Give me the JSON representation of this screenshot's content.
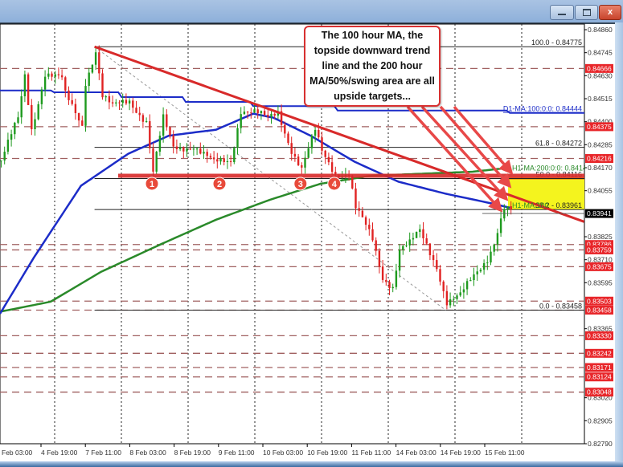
{
  "window": {
    "close_label": "x"
  },
  "annotation": "The 100 hour MA, the topside downward trend line and the 200 hour MA/50%/swing area are all upside targets...",
  "colors": {
    "bull": "#1e9a1e",
    "bear": "#e02222",
    "ma100": "#1c2cc8",
    "ma200": "#2a8a2a",
    "trend": "#d82a2a",
    "level_label": "#e8262a",
    "zone": "#f4f41e"
  },
  "chart_data": {
    "type": "candlestick",
    "title": "",
    "ylim": [
      0.8279,
      0.8486
    ],
    "y_ticks": [
      "0.84860",
      "0.84745",
      "0.84630",
      "0.84515",
      "0.84400",
      "0.84285",
      "0.84170",
      "0.84055",
      "0.83825",
      "0.83710",
      "0.83595",
      "0.83365",
      "0.83020",
      "0.82905",
      "0.82790"
    ],
    "x_ticks": [
      {
        "index": 12,
        "label": "4 Feb 19:00"
      },
      {
        "index": 25,
        "label": "7 Feb 11:00"
      },
      {
        "index": 38,
        "label": "8 Feb 03:00"
      },
      {
        "index": 51,
        "label": "8 Feb 19:00"
      },
      {
        "index": 64,
        "label": "9 Feb 11:00"
      },
      {
        "index": 77,
        "label": "10 Feb 03:00"
      },
      {
        "index": 90,
        "label": "10 Feb 19:00"
      },
      {
        "index": 103,
        "label": "11 Feb 11:00"
      },
      {
        "index": 116,
        "label": "14 Feb 03:00"
      },
      {
        "index": 129,
        "label": "14 Feb 19:00"
      },
      {
        "index": 142,
        "label": "15 Feb 11:00"
      }
    ],
    "first_x_label": "Feb 03:00",
    "current_price": "0.83941",
    "price_path": [
      [
        0,
        0.84206
      ],
      [
        5,
        0.84407
      ],
      [
        7,
        0.84627
      ],
      [
        9,
        0.84367
      ],
      [
        13,
        0.84647
      ],
      [
        18,
        0.84607
      ],
      [
        19,
        0.84527
      ],
      [
        24,
        0.84387
      ],
      [
        25,
        0.84607
      ],
      [
        28,
        0.8476
      ],
      [
        30,
        0.84527
      ],
      [
        33,
        0.84467
      ],
      [
        38,
        0.84507
      ],
      [
        43,
        0.84407
      ],
      [
        45,
        0.84146
      ],
      [
        48,
        0.84407
      ],
      [
        51,
        0.84266
      ],
      [
        57,
        0.84286
      ],
      [
        63,
        0.84186
      ],
      [
        68,
        0.84206
      ],
      [
        71,
        0.84467
      ],
      [
        75,
        0.84447
      ],
      [
        79,
        0.84407
      ],
      [
        82,
        0.84447
      ],
      [
        86,
        0.84266
      ],
      [
        89,
        0.84166
      ],
      [
        93,
        0.84347
      ],
      [
        95,
        0.84246
      ],
      [
        99,
        0.84146
      ],
      [
        103,
        0.84146
      ],
      [
        105,
        0.83966
      ],
      [
        110,
        0.83805
      ],
      [
        113,
        0.83625
      ],
      [
        116,
        0.83584
      ],
      [
        118,
        0.83765
      ],
      [
        121,
        0.83785
      ],
      [
        124,
        0.83845
      ],
      [
        129,
        0.83685
      ],
      [
        132,
        0.83504
      ],
      [
        136,
        0.83524
      ],
      [
        140,
        0.83625
      ],
      [
        144,
        0.83725
      ],
      [
        146,
        0.83805
      ],
      [
        149,
        0.83966
      ],
      [
        151,
        0.83946
      ]
    ],
    "fib_levels": [
      {
        "label": "100.0 - 0.84775",
        "price": 0.84775
      },
      {
        "label": "61.8 - 0.84272",
        "price": 0.84272
      },
      {
        "label": "50.0 - 0.84116",
        "price": 0.84116
      },
      {
        "label": "38.2 - 0.83961",
        "price": 0.83961
      },
      {
        "label": "0.0 - 0.83458",
        "price": 0.83458
      }
    ],
    "ma_labels": [
      {
        "label": "D1-MA:100:0:0: 0.84444",
        "price": 0.84444
      },
      {
        "label": "H1-MA:200:0:0: 0.84148",
        "price": 0.84148
      },
      {
        "label": "H1-MA:100",
        "price": 0.83961
      }
    ],
    "ma100_h1": [
      [
        0,
        0.8344
      ],
      [
        10,
        0.8372
      ],
      [
        24,
        0.8408
      ],
      [
        38,
        0.8424
      ],
      [
        50,
        0.8433
      ],
      [
        64,
        0.8436
      ],
      [
        75,
        0.8444
      ],
      [
        81,
        0.8442
      ],
      [
        92,
        0.8433
      ],
      [
        105,
        0.842
      ],
      [
        118,
        0.841
      ],
      [
        132,
        0.8404
      ],
      [
        146,
        0.8399
      ],
      [
        151,
        0.8397
      ]
    ],
    "ma200_h1": [
      [
        0,
        0.8345
      ],
      [
        15,
        0.835
      ],
      [
        30,
        0.8365
      ],
      [
        48,
        0.8379
      ],
      [
        64,
        0.8391
      ],
      [
        80,
        0.8401
      ],
      [
        95,
        0.8409
      ],
      [
        110,
        0.8413
      ],
      [
        125,
        0.8414
      ],
      [
        140,
        0.8415
      ],
      [
        151,
        0.8417
      ]
    ],
    "d1_ma100_steps": [
      [
        0,
        0.84556
      ],
      [
        16,
        0.84547
      ],
      [
        36,
        0.84523
      ],
      [
        55,
        0.84499
      ],
      [
        75,
        0.84478
      ],
      [
        100,
        0.84456
      ],
      [
        151,
        0.84444
      ]
    ],
    "support_line_price": 0.8413,
    "support_markers": [
      {
        "label": "1",
        "index": 45
      },
      {
        "label": "2",
        "index": 65
      },
      {
        "label": "3",
        "index": 89
      },
      {
        "label": "4",
        "index": 99
      }
    ],
    "trendline": [
      [
        28,
        0.84775
      ],
      [
        173,
        0.839
      ]
    ],
    "fib_diagonal": [
      [
        28,
        0.84775
      ],
      [
        132,
        0.83458
      ]
    ],
    "target_zone": [
      0.83961,
      0.84116
    ],
    "level_labels": [
      "0.84666",
      "0.84375",
      "0.84216",
      "0.83786",
      "0.83759",
      "0.83675",
      "0.83503",
      "0.83458",
      "0.83330",
      "0.83242",
      "0.83171",
      "0.83124",
      "0.83048"
    ]
  }
}
